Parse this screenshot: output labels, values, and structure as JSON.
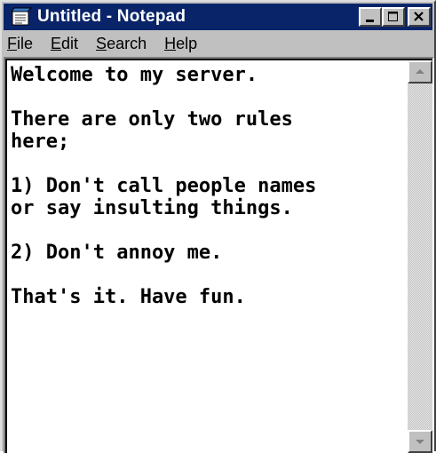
{
  "window": {
    "title": "Untitled - Notepad",
    "title_bar_color": "#0a246a",
    "icon": "notepad-icon"
  },
  "caption_buttons": {
    "minimize_icon": "minimize-icon",
    "maximize_icon": "maximize-icon",
    "close_icon": "close-icon"
  },
  "menu": {
    "items": [
      {
        "mnemonic": "F",
        "rest": "ile"
      },
      {
        "mnemonic": "E",
        "rest": "dit"
      },
      {
        "mnemonic": "S",
        "rest": "earch"
      },
      {
        "mnemonic": "H",
        "rest": "elp"
      }
    ]
  },
  "editor": {
    "text": "Welcome to my server.\n\nThere are only two rules\nhere;\n\n1) Don't call people names\nor say insulting things.\n\n2) Don't annoy me.\n\nThat's it. Have fun."
  },
  "scrollbar": {
    "up_icon": "scroll-up-arrow-icon",
    "down_icon": "scroll-down-arrow-icon"
  }
}
